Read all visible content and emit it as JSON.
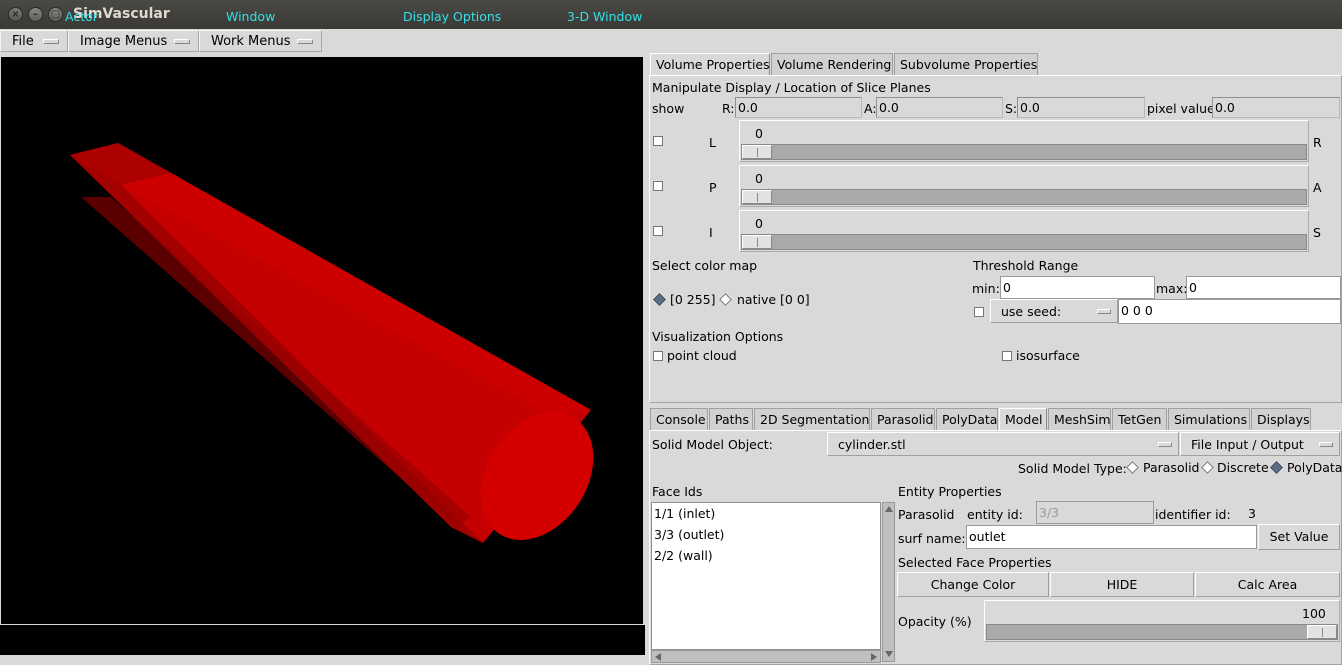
{
  "window": {
    "title": "SimVascular"
  },
  "menubar": [
    {
      "label": "File"
    },
    {
      "label": "Image Menus"
    },
    {
      "label": "Work Menus"
    }
  ],
  "viewer": {
    "object_color": "#d40000",
    "background": "#000000",
    "status_bar": [
      "Actor",
      "Window",
      "Display Options",
      "3-D Window"
    ],
    "status_color": "#33e0e8"
  },
  "volume_tabs": [
    "Volume Properties",
    "Volume Rendering",
    "Subvolume Properties"
  ],
  "volume": {
    "section_title": "Manipulate Display / Location of Slice Planes",
    "show_label": "show",
    "coords": [
      {
        "label": "R:",
        "value": "0.0"
      },
      {
        "label": "A:",
        "value": "0.0"
      },
      {
        "label": "S:",
        "value": "0.0"
      },
      {
        "label": "pixel value:",
        "value": "0.0"
      }
    ],
    "sliders": [
      {
        "left": "L",
        "right": "R",
        "value": "0"
      },
      {
        "left": "P",
        "right": "A",
        "value": "0"
      },
      {
        "left": "I",
        "right": "S",
        "value": "0"
      }
    ],
    "color_map": {
      "title": "Select color map",
      "options": [
        {
          "label": "[0 255]",
          "selected": true
        },
        {
          "label": "native [0 0]",
          "selected": false
        }
      ]
    },
    "threshold": {
      "title": "Threshold Range",
      "min_label": "min:",
      "min_value": "0",
      "max_label": "max:",
      "max_value": "0",
      "seed_button": "use seed:",
      "seed_value": "0 0 0"
    },
    "visualization": {
      "title": "Visualization Options",
      "point_cloud": "point cloud",
      "isosurface": "isosurface"
    }
  },
  "tools_tabs": [
    "Console",
    "Paths",
    "2D Segmentation",
    "Parasolid",
    "PolyData",
    "Model",
    "MeshSim",
    "TetGen",
    "Simulations",
    "Displays"
  ],
  "model": {
    "object_label": "Solid Model Object:",
    "object_value": "cylinder.stl",
    "file_io_button": "File Input / Output",
    "type_label": "Solid Model Type:",
    "types": [
      {
        "label": "Parasolid",
        "selected": false
      },
      {
        "label": "Discrete",
        "selected": false
      },
      {
        "label": "PolyData",
        "selected": true
      }
    ],
    "face_ids_title": "Face Ids",
    "faces": [
      "1/1 (inlet)",
      "3/3 (outlet)",
      "2/2 (wall)"
    ],
    "entity_title": "Entity Properties",
    "parasolid_label": "Parasolid",
    "entity_id_label": "entity id:",
    "entity_id_value": "3/3",
    "identifier_label": "identifier id:",
    "identifier_value": "3",
    "surf_name_label": "surf name:",
    "surf_name_value": "outlet",
    "set_value_button": "Set Value",
    "selected_face_title": "Selected Face Properties",
    "change_color_button": "Change Color",
    "hide_button": "HIDE",
    "calc_area_button": "Calc Area",
    "opacity_label": "Opacity (%)",
    "opacity_value": "100",
    "opacity_fraction": 1.0
  }
}
